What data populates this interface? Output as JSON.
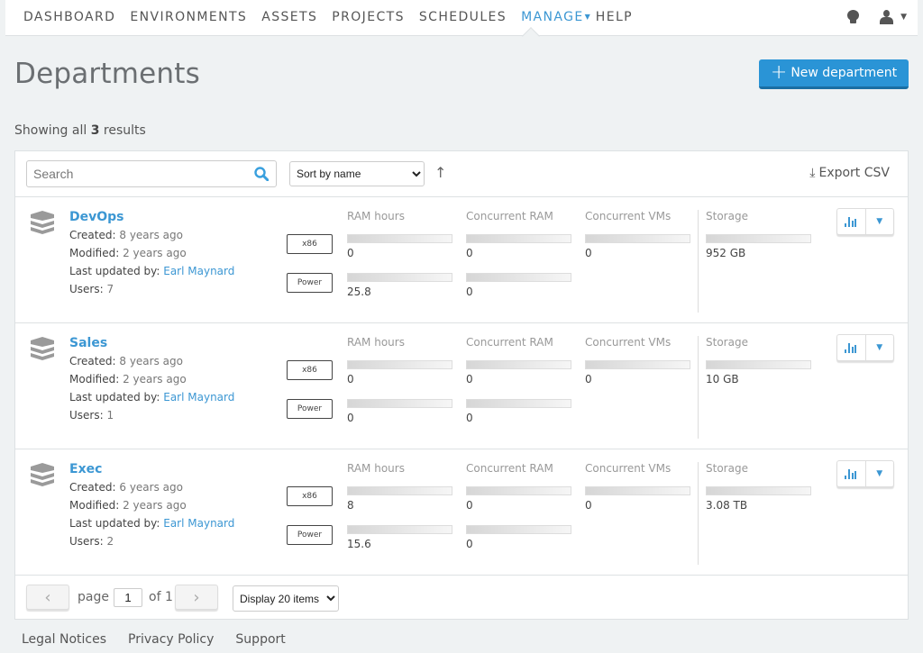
{
  "nav": {
    "items": [
      {
        "label": "DASHBOARD",
        "active": false
      },
      {
        "label": "ENVIRONMENTS",
        "active": false
      },
      {
        "label": "ASSETS",
        "active": false
      },
      {
        "label": "PROJECTS",
        "active": false
      },
      {
        "label": "SCHEDULES",
        "active": false
      },
      {
        "label": "MANAGE",
        "active": true,
        "has_caret": true
      },
      {
        "label": "HELP",
        "active": false
      }
    ],
    "right_icons": [
      "lightbulb-icon",
      "user-icon"
    ]
  },
  "header": {
    "title": "Departments",
    "new_button_label": "New department"
  },
  "results": {
    "prefix": "Showing all",
    "count": "3",
    "suffix": "results"
  },
  "toolbar": {
    "search_placeholder": "Search",
    "sort_selected": "Sort by name",
    "sort_direction": "ascending",
    "export_label": "Export CSV"
  },
  "labels": {
    "created": "Created:",
    "modified": "Modified:",
    "last_updated_by": "Last updated by:",
    "users": "Users:",
    "ram_hours": "RAM hours",
    "concurrent_ram": "Concurrent RAM",
    "concurrent_vms": "Concurrent VMs",
    "storage": "Storage",
    "arch_x86": "x86",
    "arch_power": "Power"
  },
  "departments": [
    {
      "name": "DevOps",
      "created": "8 years ago",
      "modified": "2 years ago",
      "last_updated_by": "Earl Maynard",
      "users": "7",
      "x86": {
        "ram_hours": "0",
        "concurrent_ram": "0",
        "concurrent_vms": "0"
      },
      "power": {
        "ram_hours": "25.8",
        "concurrent_ram": "0"
      },
      "storage": "952 GB"
    },
    {
      "name": "Sales",
      "created": "8 years ago",
      "modified": "2 years ago",
      "last_updated_by": "Earl Maynard",
      "users": "1",
      "x86": {
        "ram_hours": "0",
        "concurrent_ram": "0",
        "concurrent_vms": "0"
      },
      "power": {
        "ram_hours": "0",
        "concurrent_ram": "0"
      },
      "storage": "10 GB"
    },
    {
      "name": "Exec",
      "created": "6 years ago",
      "modified": "2 years ago",
      "last_updated_by": "Earl Maynard",
      "users": "2",
      "x86": {
        "ram_hours": "8",
        "concurrent_ram": "0",
        "concurrent_vms": "0"
      },
      "power": {
        "ram_hours": "15.6",
        "concurrent_ram": "0"
      },
      "storage": "3.08 TB"
    }
  ],
  "pager": {
    "page_label": "page",
    "current_page": "1",
    "of_label": "of 1",
    "display_selected": "Display 20 items"
  },
  "footer": {
    "links": [
      "Legal Notices",
      "Privacy Policy",
      "Support"
    ]
  },
  "colors": {
    "accent": "#3c97d3",
    "primary_button": "#2a94d6",
    "background": "#eff2f3"
  }
}
